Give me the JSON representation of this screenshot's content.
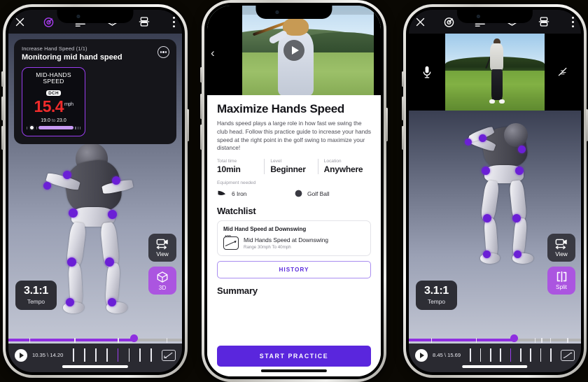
{
  "phone1": {
    "toolbar": {
      "close": "close-icon",
      "items": [
        "target-icon",
        "lines-icon",
        "layers-icon",
        "split-frame-icon",
        "more-vertical-icon"
      ]
    },
    "card": {
      "subtitle": "Increase Hand Speed (1/1)",
      "title": "Monitoring mid hand speed"
    },
    "gauge": {
      "label_line1": "MID-HANDS",
      "label_line2": "SPEED",
      "tag": "DCH",
      "value": "15.4",
      "unit": "mph",
      "range_low": "19.0",
      "range_to": "to",
      "range_high": "23.0"
    },
    "tempo": {
      "value": "3.1:1",
      "label": "Tempo"
    },
    "buttons": {
      "view": "View",
      "mode": "3D"
    },
    "footer": {
      "time": "10.35 \\ 14.20"
    },
    "scrub": {
      "percent": 72
    }
  },
  "phone2": {
    "hero": {
      "back": "chevron-left-icon",
      "play": "play-icon"
    },
    "title": "Maximize Hands Speed",
    "description": "Hands speed plays a large role in how fast we swing the club head. Follow this practice guide to increase your hands speed at the right point in the golf swing to maximize your distance!",
    "meta": [
      {
        "label": "Total time",
        "value": "10min"
      },
      {
        "label": "Level",
        "value": "Beginner"
      },
      {
        "label": "Location",
        "value": "Anywhere"
      }
    ],
    "equipment_label": "Equipment needed",
    "equipment": [
      {
        "icon": "golf-club-icon",
        "name": "6 Iron"
      },
      {
        "icon": "golf-ball-icon",
        "name": "Golf Ball"
      }
    ],
    "watchlist_heading": "Watchlist",
    "watchlist": {
      "card_title": "Mid Hand Speed at Downswing",
      "item_name": "Mid Hands Speed at Downswing",
      "item_sub": "Range 30mph To 40mph",
      "icon_badge": "ADD"
    },
    "history_button": "HISTORY",
    "summary_heading": "Summary",
    "start_button": "START PRACTICE"
  },
  "phone3": {
    "toolbar": {
      "close": "close-icon",
      "items": [
        "target-icon",
        "lines-icon",
        "layers-icon",
        "split-frame-icon",
        "more-vertical-icon"
      ]
    },
    "video": {
      "mic": "microphone-icon",
      "draw": "scribble-icon"
    },
    "tempo": {
      "value": "3.1:1",
      "label": "Tempo"
    },
    "buttons": {
      "view": "View",
      "mode": "Split"
    },
    "footer": {
      "time": "8.45 \\ 15.69"
    },
    "scrub": {
      "percent": 62
    }
  },
  "colors": {
    "accent_purple": "#8f2fe0",
    "button_purple": "#ab55e0",
    "start_purple": "#5a26dd",
    "history_purple": "#5b2bdc",
    "value_red": "#ef2b2b",
    "joint_purple": "#6b1fd6",
    "page_bg": "#0a0803"
  }
}
